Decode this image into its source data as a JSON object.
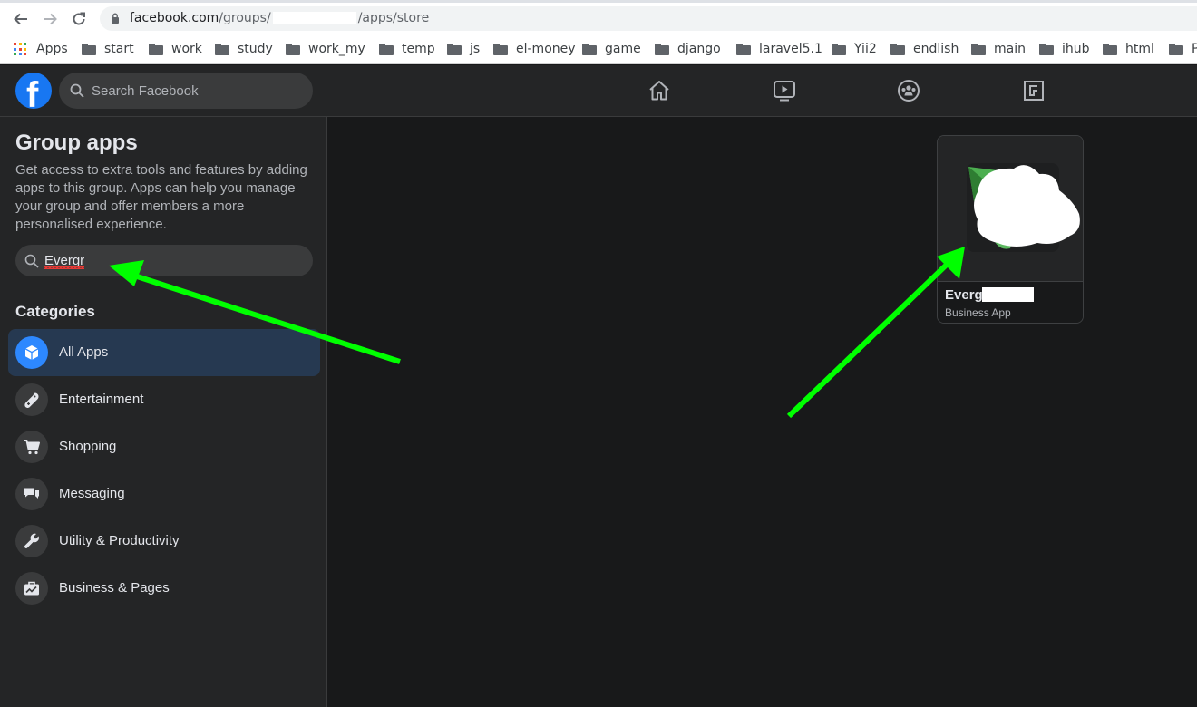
{
  "browser": {
    "url_host": "facebook.com",
    "url_path_start": "/groups/",
    "url_path_end": "/apps/store",
    "bookmarks": [
      {
        "label": "Apps",
        "type": "apps"
      },
      {
        "label": "start",
        "type": "folder"
      },
      {
        "label": "work",
        "type": "folder"
      },
      {
        "label": "study",
        "type": "folder"
      },
      {
        "label": "work_my",
        "type": "folder"
      },
      {
        "label": "temp",
        "type": "folder"
      },
      {
        "label": "js",
        "type": "folder"
      },
      {
        "label": "el-money",
        "type": "folder"
      },
      {
        "label": "game",
        "type": "folder"
      },
      {
        "label": "django",
        "type": "folder"
      },
      {
        "label": "laravel5.1",
        "type": "folder"
      },
      {
        "label": "Yii2",
        "type": "folder"
      },
      {
        "label": "endlish",
        "type": "folder"
      },
      {
        "label": "main",
        "type": "folder"
      },
      {
        "label": "ihub",
        "type": "folder"
      },
      {
        "label": "html",
        "type": "folder"
      },
      {
        "label": "P",
        "type": "folder"
      }
    ]
  },
  "fb": {
    "logo": "f",
    "search_placeholder": "Search Facebook",
    "nav_icons": [
      "home-icon",
      "watch-icon",
      "groups-icon",
      "gaming-icon"
    ]
  },
  "sidebar": {
    "title": "Group apps",
    "description": "Get access to extra tools and features by adding apps to this group. Apps can help you manage your group and offer members a more personalised experience.",
    "search_value": "Evergr",
    "categories_title": "Categories",
    "categories": [
      {
        "label": "All Apps",
        "icon": "cube-icon",
        "active": true
      },
      {
        "label": "Entertainment",
        "icon": "gamepad-icon",
        "active": false
      },
      {
        "label": "Shopping",
        "icon": "cart-icon",
        "active": false
      },
      {
        "label": "Messaging",
        "icon": "chat-bubbles-icon",
        "active": false
      },
      {
        "label": "Utility & Productivity",
        "icon": "wrench-icon",
        "active": false
      },
      {
        "label": "Business & Pages",
        "icon": "briefcase-icon",
        "active": false
      }
    ]
  },
  "results": [
    {
      "name": "Everg",
      "type": "Business App"
    }
  ],
  "colors": {
    "fb_blue": "#1877f2",
    "active_cat_bg": "#263951",
    "annotation_arrow": "#00ff00"
  }
}
